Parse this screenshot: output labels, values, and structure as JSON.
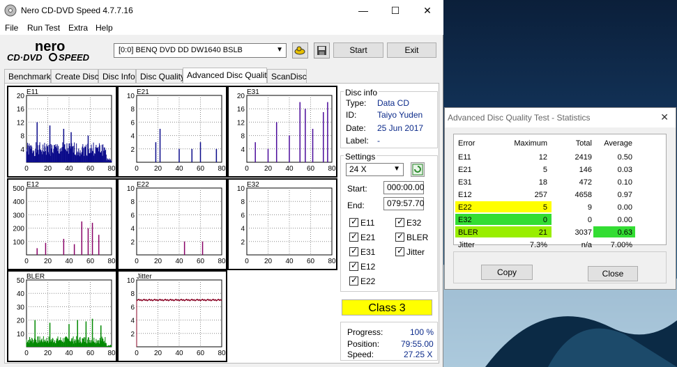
{
  "app": {
    "title": "Nero CD-DVD Speed 4.7.7.16"
  },
  "menu": [
    "File",
    "Run Test",
    "Extra",
    "Help"
  ],
  "drive": {
    "selected": "[0:0]   BENQ DVD DD DW1640 BSLB"
  },
  "buttons": {
    "start": "Start",
    "exit": "Exit"
  },
  "tabs": [
    "Benchmark",
    "Create Disc",
    "Disc Info",
    "Disc Quality",
    "Advanced Disc Quality",
    "ScanDisc"
  ],
  "disc_info": {
    "legend": "Disc info",
    "type_label": "Type:",
    "type": "Data CD",
    "id_label": "ID:",
    "id": "Taiyo Yuden",
    "date_label": "Date:",
    "date": "25 Jun 2017",
    "label_label": "Label:",
    "label": "-"
  },
  "settings": {
    "legend": "Settings",
    "speed": "24 X",
    "start_label": "Start:",
    "start": "000:00.00",
    "end_label": "End:",
    "end": "079:57.70",
    "checks": [
      "E11",
      "E32",
      "E21",
      "BLER",
      "E31",
      "Jitter",
      "E12",
      "E22"
    ]
  },
  "class": "Class 3",
  "progress": {
    "progress_label": "Progress:",
    "progress": "100 %",
    "position_label": "Position:",
    "position": "79:55.00",
    "speed_label": "Speed:",
    "speed": "27.25 X"
  },
  "stats": {
    "title": "Advanced Disc Quality Test - Statistics",
    "headers": [
      "Error",
      "Maximum",
      "Total",
      "Average"
    ],
    "rows": [
      [
        "E11",
        "12",
        "2419",
        "0.50"
      ],
      [
        "E21",
        "5",
        "146",
        "0.03"
      ],
      [
        "E31",
        "18",
        "472",
        "0.10"
      ],
      [
        "E12",
        "257",
        "4658",
        "0.97"
      ],
      [
        "E22",
        "5",
        "9",
        "0.00"
      ],
      [
        "E32",
        "0",
        "0",
        "0.00"
      ],
      [
        "BLER",
        "21",
        "3037",
        "0.63"
      ],
      [
        "Jitter",
        "7.3%",
        "n/a",
        "7.00%"
      ]
    ],
    "copy": "Copy",
    "close": "Close",
    "colors": {
      "yellow": "#ffff00",
      "green": "#33dd33",
      "lime": "#99ee00"
    }
  },
  "chart_data": [
    {
      "type": "bar",
      "title": "E11",
      "ylim": [
        0,
        20
      ],
      "yticks": [
        "20",
        "16",
        "12",
        "8",
        "4"
      ],
      "xticks": [
        "0",
        "20",
        "40",
        "60",
        "80"
      ],
      "color": "#0a0a8a",
      "seed": 1,
      "level": 6,
      "spikes": [
        [
          10,
          12
        ],
        [
          22,
          11
        ],
        [
          35,
          10
        ],
        [
          42,
          9
        ],
        [
          58,
          8
        ]
      ]
    },
    {
      "type": "bar",
      "title": "E21",
      "ylim": [
        0,
        10
      ],
      "yticks": [
        "10",
        "8",
        "6",
        "4",
        "2"
      ],
      "xticks": [
        "0",
        "20",
        "40",
        "60",
        "80"
      ],
      "color": "#0a0a8a",
      "seed": 2,
      "level": 0,
      "spikes": [
        [
          18,
          3
        ],
        [
          22,
          5
        ],
        [
          40,
          2
        ],
        [
          52,
          2
        ],
        [
          60,
          3
        ],
        [
          75,
          2
        ]
      ]
    },
    {
      "type": "bar",
      "title": "E31",
      "ylim": [
        0,
        20
      ],
      "yticks": [
        "20",
        "16",
        "12",
        "8",
        "4"
      ],
      "xticks": [
        "0",
        "20",
        "40",
        "60",
        "80"
      ],
      "color": "#4a0a9a",
      "seed": 3,
      "level": 0,
      "spikes": [
        [
          8,
          6
        ],
        [
          20,
          4
        ],
        [
          28,
          12
        ],
        [
          40,
          8
        ],
        [
          50,
          18
        ],
        [
          55,
          16
        ],
        [
          62,
          10
        ],
        [
          72,
          15
        ],
        [
          76,
          18
        ]
      ]
    },
    {
      "type": "bar",
      "title": "E12",
      "ylim": [
        0,
        500
      ],
      "yticks": [
        "500",
        "400",
        "300",
        "200",
        "100"
      ],
      "xticks": [
        "0",
        "20",
        "40",
        "60",
        "80"
      ],
      "color": "#880066",
      "seed": 4,
      "level": 0,
      "spikes": [
        [
          10,
          50
        ],
        [
          18,
          90
        ],
        [
          35,
          120
        ],
        [
          45,
          80
        ],
        [
          52,
          250
        ],
        [
          58,
          200
        ],
        [
          62,
          240
        ],
        [
          68,
          150
        ]
      ]
    },
    {
      "type": "bar",
      "title": "E22",
      "ylim": [
        0,
        10
      ],
      "yticks": [
        "10",
        "8",
        "6",
        "4",
        "2"
      ],
      "xticks": [
        "0",
        "20",
        "40",
        "60",
        "80"
      ],
      "color": "#880066",
      "seed": 5,
      "level": 0,
      "spikes": [
        [
          45,
          2
        ],
        [
          62,
          2
        ]
      ]
    },
    {
      "type": "bar",
      "title": "E32",
      "ylim": [
        0,
        10
      ],
      "yticks": [
        "10",
        "8",
        "6",
        "4",
        "2"
      ],
      "xticks": [
        "0",
        "20",
        "40",
        "60",
        "80"
      ],
      "color": "#880066",
      "seed": 6,
      "level": 0,
      "spikes": []
    },
    {
      "type": "bar",
      "title": "BLER",
      "ylim": [
        0,
        50
      ],
      "yticks": [
        "50",
        "40",
        "30",
        "20",
        "10"
      ],
      "xticks": [
        "0",
        "20",
        "40",
        "60",
        "80"
      ],
      "color": "#008800",
      "seed": 7,
      "level": 8,
      "spikes": [
        [
          8,
          20
        ],
        [
          22,
          18
        ],
        [
          40,
          17
        ],
        [
          48,
          20
        ],
        [
          56,
          19
        ],
        [
          62,
          21
        ],
        [
          70,
          16
        ]
      ]
    },
    {
      "type": "line",
      "title": "Jitter",
      "ylim": [
        0,
        10
      ],
      "yticks": [
        "10",
        "8",
        "6",
        "4",
        "2"
      ],
      "xticks": [
        "0",
        "20",
        "40",
        "60",
        "80"
      ],
      "color": "#880022",
      "value": 7.0
    }
  ]
}
